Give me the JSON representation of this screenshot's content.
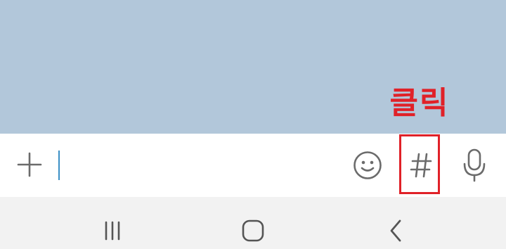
{
  "screen": {
    "background_color": "#b2c7da"
  },
  "input_bar": {
    "attach_icon": "plus-icon",
    "emoji_icon": "smiley-icon",
    "hashtag_icon": "hashtag-icon",
    "voice_icon": "microphone-icon"
  },
  "nav_bar": {
    "recents_icon": "recent-apps-icon",
    "home_icon": "home-icon",
    "back_icon": "back-icon"
  },
  "annotation": {
    "label": "클릭",
    "color": "#e02128"
  }
}
